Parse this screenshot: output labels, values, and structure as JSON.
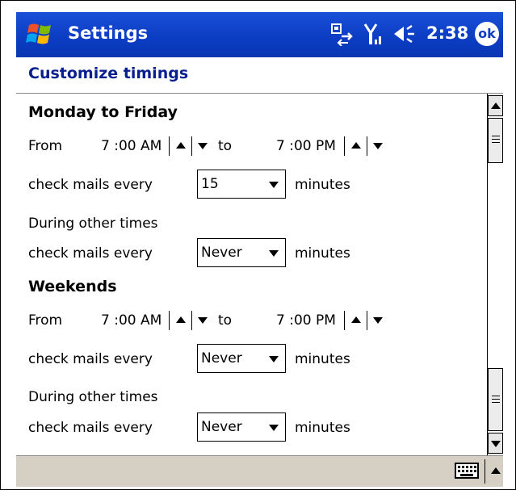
{
  "titlebar": {
    "app_title": "Settings",
    "clock": "2:38",
    "ok_label": "ok",
    "colors": {
      "bar": "#0b3cc2",
      "text": "#ffffff"
    }
  },
  "header": {
    "title": "Customize timings",
    "color": "#0a1f8f"
  },
  "weekday": {
    "heading": "Monday to Friday",
    "from_label": "From",
    "from_time": "7 :00 AM",
    "to_label": "to",
    "to_time": "7 :00 PM",
    "check_label": "check mails every",
    "check_value": "15",
    "minutes_label": "minutes",
    "other_label": "During other times",
    "other_check_label": "check mails every",
    "other_value": "Never",
    "other_minutes_label": "minutes"
  },
  "weekend": {
    "heading": "Weekends",
    "from_label": "From",
    "from_time": "7 :00 AM",
    "to_label": "to",
    "to_time": "7 :00 PM",
    "check_label": "check mails every",
    "check_value": "Never",
    "minutes_label": "minutes",
    "other_label": "During other times",
    "other_check_label": "check mails every",
    "other_value": "Never",
    "other_minutes_label": "minutes"
  },
  "icons": {
    "start": "windows-flag",
    "connectivity": "sync-arrows",
    "signal": "antenna",
    "volume": "speaker",
    "keyboard": "keyboard"
  },
  "menubar": {
    "background": "#d6cfc3"
  }
}
